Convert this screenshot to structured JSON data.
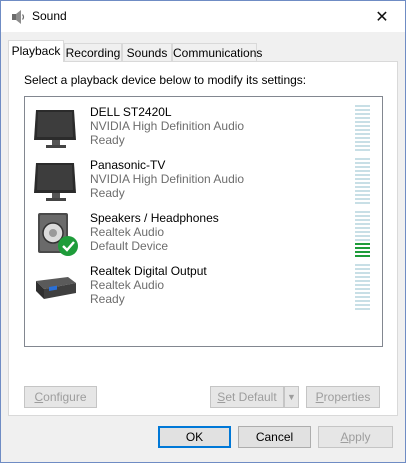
{
  "window": {
    "title": "Sound",
    "close_glyph": "✕"
  },
  "tabs": [
    {
      "label": "Playback",
      "active": true
    },
    {
      "label": "Recording",
      "active": false
    },
    {
      "label": "Sounds",
      "active": false
    },
    {
      "label": "Communications",
      "active": false
    }
  ],
  "panel": {
    "instruction": "Select a playback device below to modify its settings:"
  },
  "devices": [
    {
      "name": "DELL ST2420L",
      "driver": "NVIDIA High Definition Audio",
      "status": "Ready",
      "icon": "monitor-icon",
      "level": 0
    },
    {
      "name": "Panasonic-TV",
      "driver": "NVIDIA High Definition Audio",
      "status": "Ready",
      "icon": "tv-icon",
      "level": 0
    },
    {
      "name": "Speakers / Headphones",
      "driver": "Realtek Audio",
      "status": "Default Device",
      "icon": "speaker-icon",
      "default": true,
      "level": 0.3
    },
    {
      "name": "Realtek Digital Output",
      "driver": "Realtek Audio",
      "status": "Ready",
      "icon": "digital-output-icon",
      "level": 0
    }
  ],
  "buttons": {
    "configure_pre": "",
    "configure_u": "C",
    "configure_post": "onfigure",
    "set_default_pre": "",
    "set_default_u": "S",
    "set_default_post": "et Default",
    "properties_pre": "",
    "properties_u": "P",
    "properties_post": "roperties",
    "ok": "OK",
    "cancel": "Cancel",
    "apply_pre": "",
    "apply_u": "A",
    "apply_post": "pply",
    "dropdown_glyph": "▼"
  },
  "colors": {
    "meter_empty": "#c8dfe6",
    "meter_active": "#1e9c3a",
    "default_check": "#1e9c3a",
    "focus_border": "#0078d7"
  }
}
